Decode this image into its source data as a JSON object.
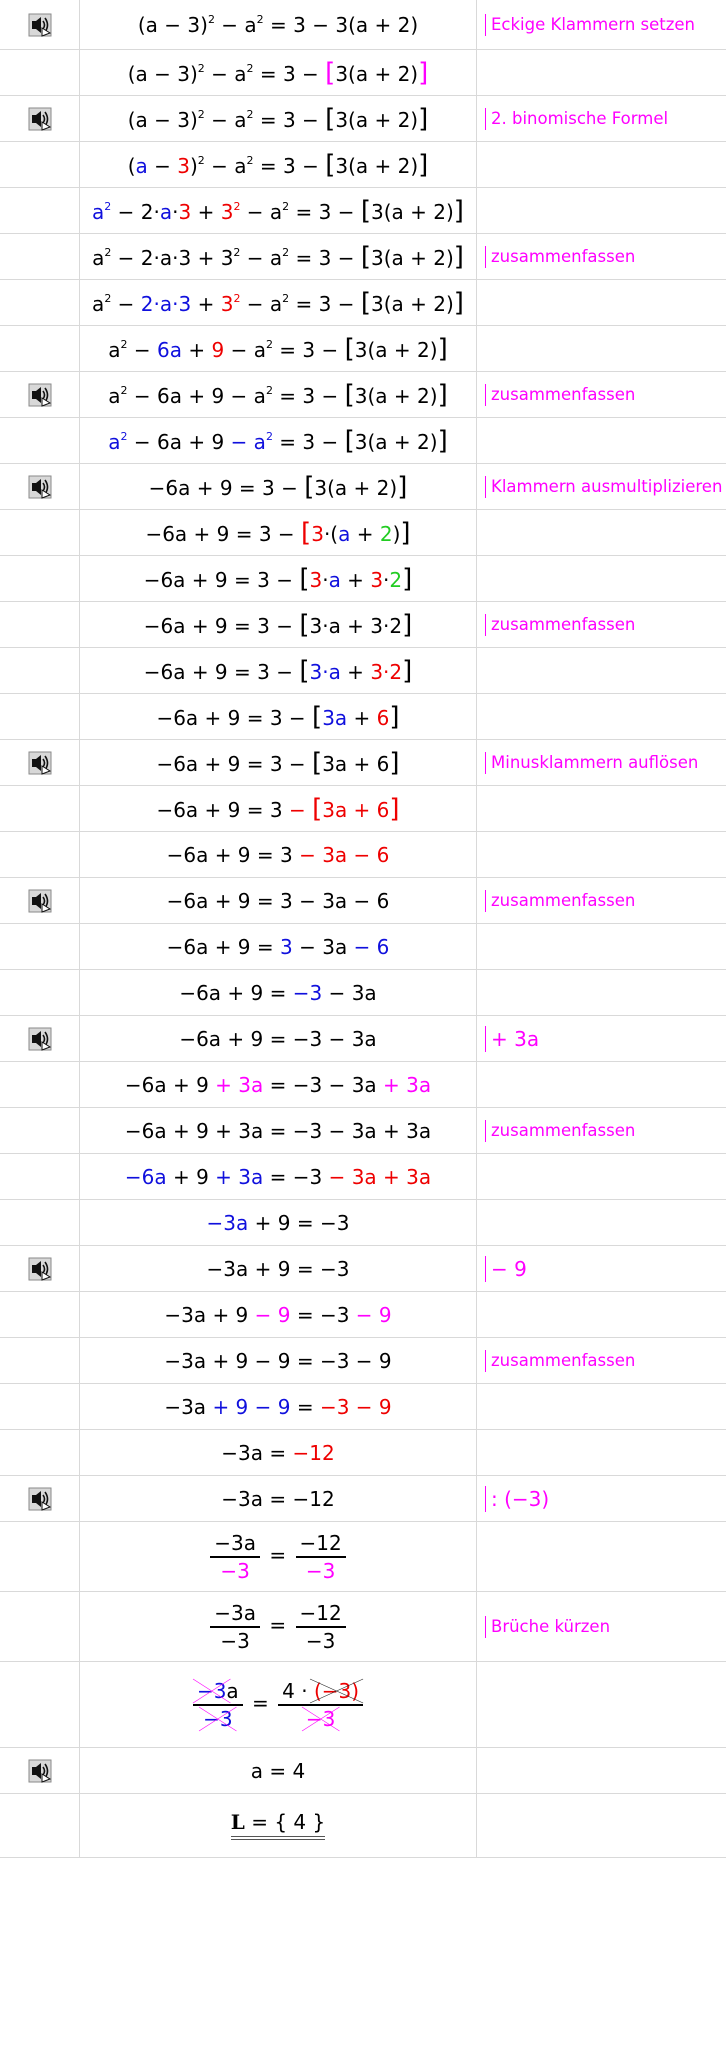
{
  "rows": [
    {
      "icon": true,
      "note": "Eckige Klammern setzen",
      "eq": [
        [
          "k",
          "(a − 3)"
        ],
        [
          "sup",
          "2"
        ],
        [
          "k",
          " − a"
        ],
        [
          "sup",
          "2"
        ],
        [
          "k",
          " = 3 − 3(a + 2)"
        ]
      ]
    },
    {
      "icon": false,
      "note": "",
      "eq": [
        [
          "k",
          "(a − 3)"
        ],
        [
          "sup",
          "2"
        ],
        [
          "k",
          " − a"
        ],
        [
          "sup",
          "2"
        ],
        [
          "k",
          " = 3 − "
        ],
        [
          "mbr",
          "["
        ],
        [
          "k",
          "3(a + 2)"
        ],
        [
          "mbr",
          "]"
        ]
      ]
    },
    {
      "icon": true,
      "note": "2. binomische Formel",
      "eq": [
        [
          "k",
          "(a − 3)"
        ],
        [
          "sup",
          "2"
        ],
        [
          "k",
          " − a"
        ],
        [
          "sup",
          "2"
        ],
        [
          "k",
          " = 3 − "
        ],
        [
          "br",
          "["
        ],
        [
          "k",
          "3(a + 2)"
        ],
        [
          "br",
          "]"
        ]
      ]
    },
    {
      "icon": false,
      "note": "",
      "eq": [
        [
          "k",
          "("
        ],
        [
          "b",
          "a"
        ],
        [
          "k",
          " − "
        ],
        [
          "r",
          "3"
        ],
        [
          "k",
          ")"
        ],
        [
          "sup",
          "2"
        ],
        [
          "k",
          " − a"
        ],
        [
          "sup",
          "2"
        ],
        [
          "k",
          " = 3 − "
        ],
        [
          "br",
          "["
        ],
        [
          "k",
          "3(a + 2)"
        ],
        [
          "br",
          "]"
        ]
      ]
    },
    {
      "icon": false,
      "note": "",
      "eq": [
        [
          "b",
          "a"
        ],
        [
          "bsup",
          "2"
        ],
        [
          "k",
          " − 2·"
        ],
        [
          "b",
          "a"
        ],
        [
          "k",
          "·"
        ],
        [
          "r",
          "3"
        ],
        [
          "k",
          " + "
        ],
        [
          "r",
          "3"
        ],
        [
          "rsup",
          "2"
        ],
        [
          "k",
          " − a"
        ],
        [
          "sup",
          "2"
        ],
        [
          "k",
          " = 3 − "
        ],
        [
          "br",
          "["
        ],
        [
          "k",
          "3(a + 2)"
        ],
        [
          "br",
          "]"
        ]
      ]
    },
    {
      "icon": false,
      "note": "zusammenfassen",
      "eq": [
        [
          "k",
          "a"
        ],
        [
          "sup",
          "2"
        ],
        [
          "k",
          " − 2·a·3 + 3"
        ],
        [
          "sup",
          "2"
        ],
        [
          "k",
          " − a"
        ],
        [
          "sup",
          "2"
        ],
        [
          "k",
          " = 3 − "
        ],
        [
          "br",
          "["
        ],
        [
          "k",
          "3(a + 2)"
        ],
        [
          "br",
          "]"
        ]
      ]
    },
    {
      "icon": false,
      "note": "",
      "eq": [
        [
          "k",
          "a"
        ],
        [
          "sup",
          "2"
        ],
        [
          "k",
          " − "
        ],
        [
          "b",
          "2·a·3"
        ],
        [
          "k",
          " + "
        ],
        [
          "r",
          "3"
        ],
        [
          "rsup",
          "2"
        ],
        [
          "k",
          " − a"
        ],
        [
          "sup",
          "2"
        ],
        [
          "k",
          " = 3 − "
        ],
        [
          "br",
          "["
        ],
        [
          "k",
          "3(a + 2)"
        ],
        [
          "br",
          "]"
        ]
      ]
    },
    {
      "icon": false,
      "note": "",
      "eq": [
        [
          "k",
          "a"
        ],
        [
          "sup",
          "2"
        ],
        [
          "k",
          " − "
        ],
        [
          "b",
          "6a"
        ],
        [
          "k",
          " + "
        ],
        [
          "r",
          "9"
        ],
        [
          "k",
          " − a"
        ],
        [
          "sup",
          "2"
        ],
        [
          "k",
          " = 3 − "
        ],
        [
          "br",
          "["
        ],
        [
          "k",
          "3(a + 2)"
        ],
        [
          "br",
          "]"
        ]
      ]
    },
    {
      "icon": true,
      "note": "zusammenfassen",
      "eq": [
        [
          "k",
          "a"
        ],
        [
          "sup",
          "2"
        ],
        [
          "k",
          " − 6a + 9 − a"
        ],
        [
          "sup",
          "2"
        ],
        [
          "k",
          " = 3 − "
        ],
        [
          "br",
          "["
        ],
        [
          "k",
          "3(a + 2)"
        ],
        [
          "br",
          "]"
        ]
      ]
    },
    {
      "icon": false,
      "note": "",
      "eq": [
        [
          "b",
          "a"
        ],
        [
          "bsup",
          "2"
        ],
        [
          "k",
          " − 6a + 9 "
        ],
        [
          "b",
          "− a"
        ],
        [
          "bsup",
          "2"
        ],
        [
          "k",
          " = 3 − "
        ],
        [
          "br",
          "["
        ],
        [
          "k",
          "3(a + 2)"
        ],
        [
          "br",
          "]"
        ]
      ]
    },
    {
      "icon": true,
      "note": "Klammern ausmultiplizieren",
      "eq": [
        [
          "k",
          "−6a + 9 = 3 − "
        ],
        [
          "br",
          "["
        ],
        [
          "k",
          "3(a + 2)"
        ],
        [
          "br",
          "]"
        ]
      ]
    },
    {
      "icon": false,
      "note": "",
      "eq": [
        [
          "k",
          "−6a + 9 = 3 − "
        ],
        [
          "rbr",
          "["
        ],
        [
          "r",
          "3"
        ],
        [
          "k",
          "·("
        ],
        [
          "b",
          "a"
        ],
        [
          "k",
          " + "
        ],
        [
          "g",
          "2"
        ],
        [
          "k",
          ")"
        ],
        [
          "br",
          "]"
        ]
      ]
    },
    {
      "icon": false,
      "note": "",
      "eq": [
        [
          "k",
          "−6a + 9 = 3 − "
        ],
        [
          "br",
          "["
        ],
        [
          "r",
          "3"
        ],
        [
          "k",
          "·"
        ],
        [
          "b",
          "a"
        ],
        [
          "k",
          " + "
        ],
        [
          "r",
          "3"
        ],
        [
          "k",
          "·"
        ],
        [
          "g",
          "2"
        ],
        [
          "br",
          "]"
        ]
      ]
    },
    {
      "icon": false,
      "note": "zusammenfassen",
      "eq": [
        [
          "k",
          "−6a + 9 = 3 − "
        ],
        [
          "br",
          "["
        ],
        [
          "k",
          "3·a + 3·2"
        ],
        [
          "br",
          "]"
        ]
      ]
    },
    {
      "icon": false,
      "note": "",
      "eq": [
        [
          "k",
          "−6a + 9 = 3 − "
        ],
        [
          "br",
          "["
        ],
        [
          "b",
          "3·a"
        ],
        [
          "k",
          " + "
        ],
        [
          "r",
          "3·2"
        ],
        [
          "br",
          "]"
        ]
      ]
    },
    {
      "icon": false,
      "note": "",
      "eq": [
        [
          "k",
          "−6a + 9 = 3 − "
        ],
        [
          "br",
          "["
        ],
        [
          "b",
          "3a"
        ],
        [
          "k",
          " + "
        ],
        [
          "r",
          "6"
        ],
        [
          "br",
          "]"
        ]
      ]
    },
    {
      "icon": true,
      "note": "Minusklammern auflösen",
      "eq": [
        [
          "k",
          "−6a + 9 = 3 − "
        ],
        [
          "br",
          "["
        ],
        [
          "k",
          "3a + 6"
        ],
        [
          "br",
          "]"
        ]
      ]
    },
    {
      "icon": false,
      "note": "",
      "eq": [
        [
          "k",
          "−6a + 9 = 3 "
        ],
        [
          "r",
          "− "
        ],
        [
          "rbr",
          "["
        ],
        [
          "r",
          "3a + 6"
        ],
        [
          "rbr",
          "]"
        ]
      ]
    },
    {
      "icon": false,
      "note": "",
      "eq": [
        [
          "k",
          "−6a + 9 = 3 "
        ],
        [
          "r",
          "− 3a − 6"
        ]
      ]
    },
    {
      "icon": true,
      "note": "zusammenfassen",
      "eq": [
        [
          "k",
          "−6a + 9 = 3 − 3a − 6"
        ]
      ]
    },
    {
      "icon": false,
      "note": "",
      "eq": [
        [
          "k",
          "−6a + 9 = "
        ],
        [
          "b",
          "3"
        ],
        [
          "k",
          " − 3a "
        ],
        [
          "b",
          "− 6"
        ]
      ]
    },
    {
      "icon": false,
      "note": "",
      "eq": [
        [
          "k",
          "−6a + 9 = "
        ],
        [
          "b",
          "−3"
        ],
        [
          "k",
          " − 3a"
        ]
      ]
    },
    {
      "icon": true,
      "note": "+ 3a",
      "noteMath": true,
      "eq": [
        [
          "k",
          "−6a + 9 = −3 − 3a"
        ]
      ]
    },
    {
      "icon": false,
      "note": "",
      "eq": [
        [
          "k",
          "−6a + 9 "
        ],
        [
          "m",
          "+ 3a"
        ],
        [
          "k",
          " = −3 − 3a "
        ],
        [
          "m",
          "+ 3a"
        ]
      ]
    },
    {
      "icon": false,
      "note": "zusammenfassen",
      "eq": [
        [
          "k",
          "−6a + 9 + 3a = −3 − 3a + 3a"
        ]
      ]
    },
    {
      "icon": false,
      "note": "",
      "eq": [
        [
          "b",
          "−6a"
        ],
        [
          "k",
          " + 9 "
        ],
        [
          "b",
          "+ 3a"
        ],
        [
          "k",
          " = −3 "
        ],
        [
          "r",
          "− 3a + 3a"
        ]
      ]
    },
    {
      "icon": false,
      "note": "",
      "eq": [
        [
          "b",
          "−3a"
        ],
        [
          "k",
          " + 9 = −3"
        ]
      ]
    },
    {
      "icon": true,
      "note": "− 9",
      "noteMath": true,
      "eq": [
        [
          "k",
          "−3a + 9 = −3"
        ]
      ]
    },
    {
      "icon": false,
      "note": "",
      "eq": [
        [
          "k",
          "−3a + 9 "
        ],
        [
          "m",
          "− 9"
        ],
        [
          "k",
          " = −3 "
        ],
        [
          "m",
          "− 9"
        ]
      ]
    },
    {
      "icon": false,
      "note": "zusammenfassen",
      "eq": [
        [
          "k",
          "−3a + 9 − 9 = −3 − 9"
        ]
      ]
    },
    {
      "icon": false,
      "note": "",
      "eq": [
        [
          "k",
          "−3a "
        ],
        [
          "b",
          "+ 9 − 9"
        ],
        [
          "k",
          " = "
        ],
        [
          "r",
          "−3 − 9"
        ]
      ]
    },
    {
      "icon": false,
      "note": "",
      "eq": [
        [
          "k",
          "−3a = "
        ],
        [
          "r",
          "−12"
        ]
      ]
    },
    {
      "icon": true,
      "note": ": (−3)",
      "noteMath": true,
      "eq": [
        [
          "k",
          "−3a = −12"
        ]
      ]
    },
    {
      "icon": false,
      "note": "",
      "frac": {
        "ln": [
          [
            "k",
            "−3a"
          ]
        ],
        "ld": [
          [
            "m",
            "−3"
          ]
        ],
        "rn": [
          [
            "k",
            "−12"
          ]
        ],
        "rd": [
          [
            "m",
            "−3"
          ]
        ]
      }
    },
    {
      "icon": false,
      "note": "Brüche kürzen",
      "frac": {
        "ln": [
          [
            "k",
            "−3a"
          ]
        ],
        "ld": [
          [
            "k",
            "−3"
          ]
        ],
        "rn": [
          [
            "k",
            "−12"
          ]
        ],
        "rd": [
          [
            "k",
            "−3"
          ]
        ]
      }
    },
    {
      "icon": false,
      "note": "",
      "frac": {
        "ln": [
          [
            "xb",
            "−3"
          ],
          [
            "k",
            "a"
          ]
        ],
        "ld": [
          [
            "xb",
            "−3"
          ]
        ],
        "rn": [
          [
            "k",
            "4 · "
          ],
          [
            "xr",
            "(−3)"
          ]
        ],
        "rd": [
          [
            "xm",
            "−3"
          ]
        ]
      }
    },
    {
      "icon": true,
      "note": "",
      "eq": [
        [
          "k",
          "a = 4"
        ]
      ]
    },
    {
      "icon": false,
      "note": "",
      "solution": true,
      "eq": [
        [
          "bb",
          "L"
        ],
        [
          "k",
          " = { 4 }"
        ]
      ]
    }
  ],
  "colors": {
    "note": "#ff00ff",
    "red": "#ee0000",
    "blue": "#1010dd",
    "green": "#22cc22",
    "grid": "#d9d9d9"
  },
  "icon_name": "speaker-play-icon"
}
